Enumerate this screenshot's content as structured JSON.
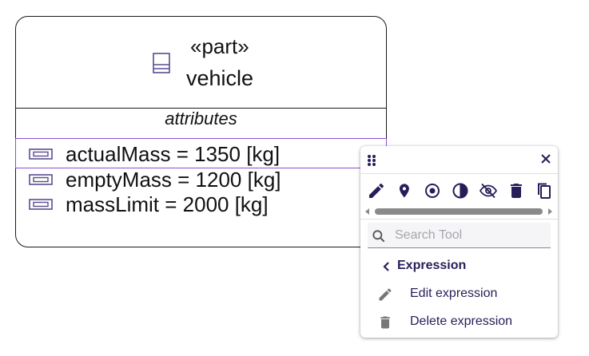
{
  "node": {
    "stereotype": "«part»",
    "name": "vehicle",
    "compartment_label": "attributes",
    "attributes": [
      {
        "text": "actualMass = 1350 [kg]",
        "selected": true
      },
      {
        "text": "emptyMass = 1200 [kg]",
        "selected": false
      },
      {
        "text": "massLimit = 2000 [kg]",
        "selected": false
      }
    ]
  },
  "palette": {
    "tools": [
      {
        "icon": "pencil-icon"
      },
      {
        "icon": "pin-icon"
      },
      {
        "icon": "target-icon"
      },
      {
        "icon": "contrast-icon"
      },
      {
        "icon": "eye-off-icon"
      },
      {
        "icon": "trash-icon"
      },
      {
        "icon": "copy-icon"
      }
    ],
    "search_placeholder": "Search Tool",
    "back_label": "Expression",
    "items": [
      {
        "label": "Edit expression",
        "icon": "pencil-icon"
      },
      {
        "label": "Delete expression",
        "icon": "trash-icon"
      }
    ]
  },
  "colors": {
    "accent": "#261e58",
    "selection": "#8a4fd8",
    "icon_purple": "#5b4d8f"
  }
}
